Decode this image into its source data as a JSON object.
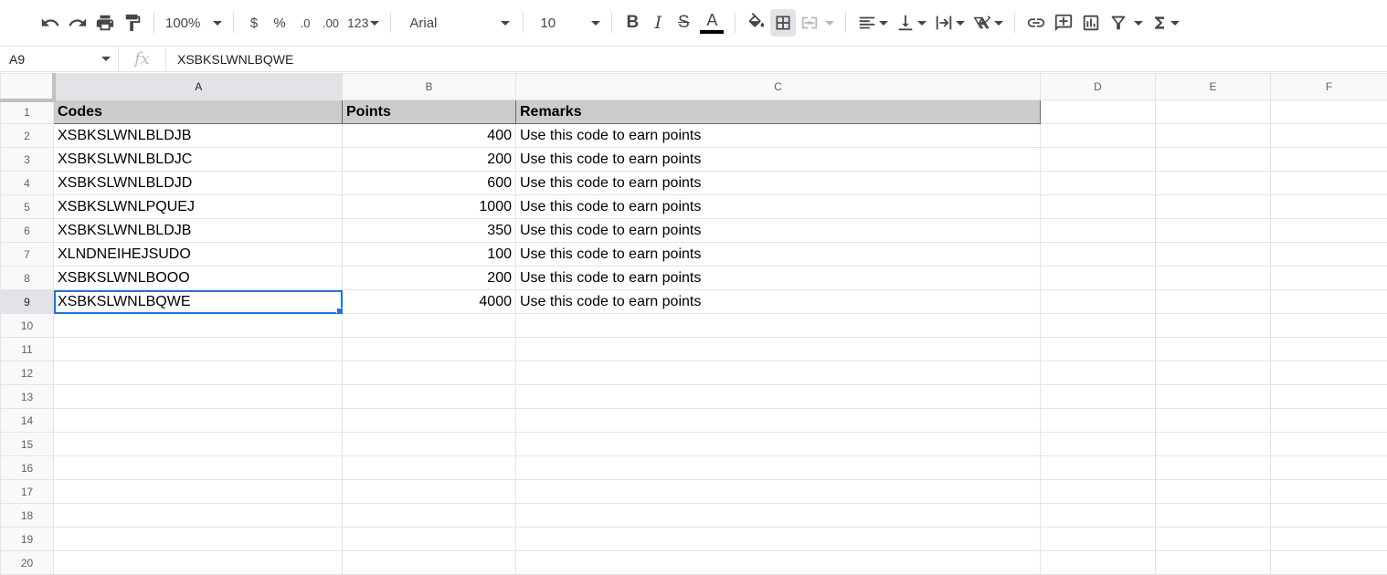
{
  "toolbar": {
    "zoom": "100%",
    "currency": "$",
    "percent": "%",
    "dec_decrease": ".0",
    "dec_increase": ".00",
    "more_formats": "123",
    "font_family": "Arial",
    "font_size": "10",
    "bold": "B",
    "italic": "I",
    "strike": "S",
    "text_color_glyph": "A"
  },
  "formula_bar": {
    "name_box": "A9",
    "fx_label": "fx",
    "content": "XSBKSLWNLBQWE"
  },
  "sheet": {
    "columns": [
      "A",
      "B",
      "C",
      "D",
      "E",
      "F"
    ],
    "row_numbers": [
      "1",
      "2",
      "3",
      "4",
      "5",
      "6",
      "7",
      "8",
      "9",
      "10",
      "11",
      "12",
      "13",
      "14",
      "15",
      "16",
      "17",
      "18",
      "19",
      "20"
    ],
    "header_row": {
      "a": "Codes",
      "b": "Points",
      "c": "Remarks"
    },
    "rows": [
      {
        "a": "XSBKSLWNLBLDJB",
        "b": "400",
        "c": "Use this code to earn points"
      },
      {
        "a": "XSBKSLWNLBLDJC",
        "b": "200",
        "c": "Use this code to earn points"
      },
      {
        "a": "XSBKSLWNLBLDJD",
        "b": "600",
        "c": "Use this code to earn points"
      },
      {
        "a": "XSBKSLWNLPQUEJ",
        "b": "1000",
        "c": "Use this code to earn points"
      },
      {
        "a": "XSBKSLWNLBLDJB",
        "b": "350",
        "c": "Use this code to earn points"
      },
      {
        "a": "XLNDNEIHEJSUDO",
        "b": "100",
        "c": "Use this code to earn points"
      },
      {
        "a": "XSBKSLWNLBOOO",
        "b": "200",
        "c": "Use this code to earn points"
      },
      {
        "a": "XSBKSLWNLBQWE",
        "b": "4000",
        "c": "Use this code to earn points"
      }
    ],
    "active_cell": "A9",
    "accent_color": "#1a73e8",
    "header_fill": "#cccccc"
  }
}
